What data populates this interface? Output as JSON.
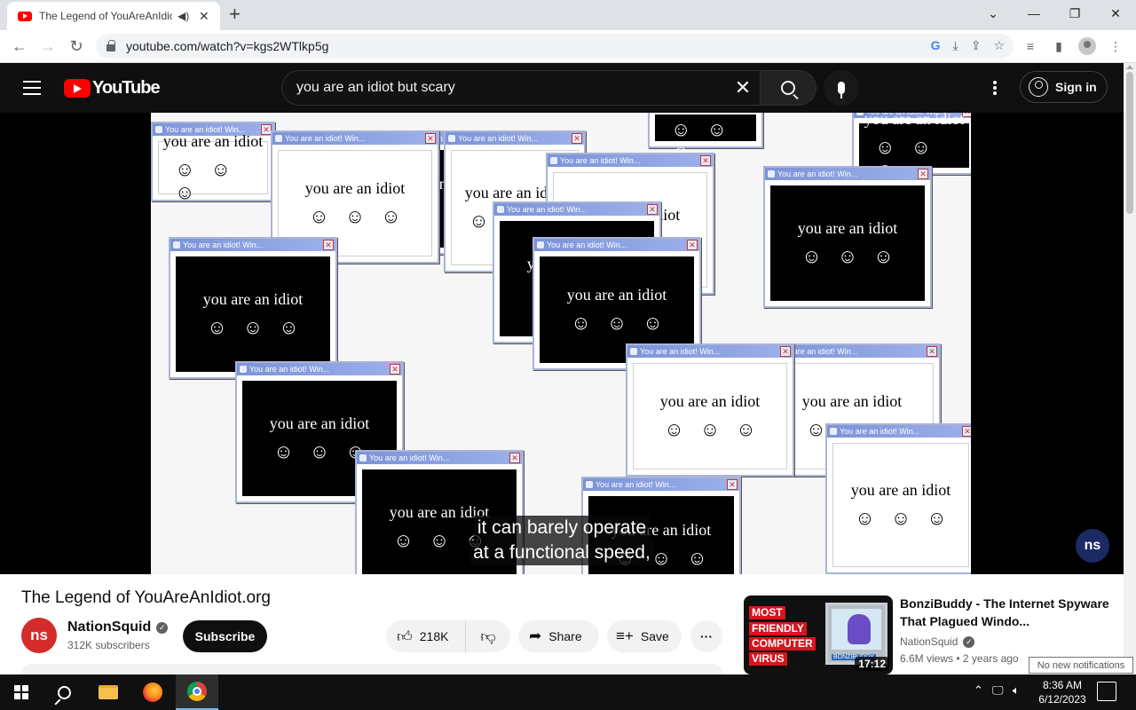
{
  "browser": {
    "tab_title": "The Legend of YouAreAnIdiot.org",
    "audio_icon": "speaker-icon",
    "url": "youtube.com/watch?v=kgs2WTlkp5g"
  },
  "youtube": {
    "logo_text": "YouTube",
    "search_query": "you are an idiot but scary",
    "signin_label": "Sign in"
  },
  "video": {
    "popup_text": "you are an idiot",
    "popup_smiles": "☺☺☺",
    "popup_titlebar": "You are an idiot!  Win...",
    "subtitle_line1": "it can barely operate",
    "subtitle_line2": "at a functional speed,",
    "watermark": "ns",
    "title": "The Legend of YouAreAnIdiot.org"
  },
  "channel": {
    "avatar": "ns",
    "name": "NationSquid",
    "subscribers": "312K subscribers",
    "subscribe_label": "Subscribe"
  },
  "actions": {
    "likes": "218K",
    "share": "Share",
    "save": "Save"
  },
  "recommendation": {
    "badge_lines": [
      "MOST",
      "FRIENDLY",
      "COMPUTER",
      "VIRUS"
    ],
    "monitor_label": "BONZIBUDDY",
    "duration": "17:12",
    "title": "BonziBuddy - The Internet Spyware That Plagued Windo...",
    "channel": "NationSquid",
    "meta": "6.6M views • 2 years ago"
  },
  "notification_tooltip": "No new notifications",
  "taskbar": {
    "time": "8:36 AM",
    "date": "6/12/2023"
  },
  "colors": {
    "yt_red": "#ff0000",
    "yt_dark": "#0f0f0f",
    "popup_titlebar": "#7b93d8",
    "taskbar": "#101010"
  }
}
